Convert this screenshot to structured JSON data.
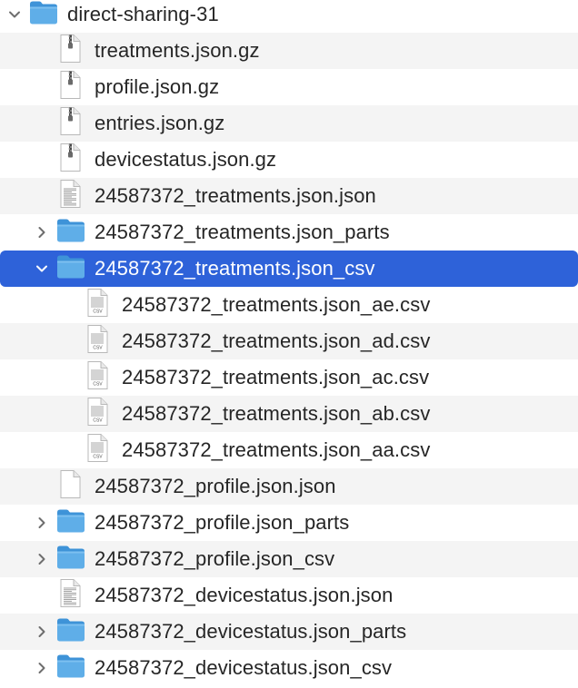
{
  "colors": {
    "selection": "#2e62d9",
    "folder_body": "#5faee8",
    "folder_tab": "#3e93d8",
    "text": "#262626",
    "selected_text": "#ffffff",
    "chevron": "#6e6e6e"
  },
  "rows": [
    {
      "label": "direct-sharing-31",
      "kind": "folder",
      "disclosure": "expanded",
      "icon": "folder-icon"
    },
    {
      "label": "treatments.json.gz",
      "kind": "gz",
      "disclosure": "none",
      "icon": "archive-file-icon"
    },
    {
      "label": "profile.json.gz",
      "kind": "gz",
      "disclosure": "none",
      "icon": "archive-file-icon"
    },
    {
      "label": "entries.json.gz",
      "kind": "gz",
      "disclosure": "none",
      "icon": "archive-file-icon"
    },
    {
      "label": "devicestatus.json.gz",
      "kind": "gz",
      "disclosure": "none",
      "icon": "archive-file-icon"
    },
    {
      "label": "24587372_treatments.json.json",
      "kind": "json",
      "disclosure": "none",
      "icon": "json-file-icon"
    },
    {
      "label": "24587372_treatments.json_parts",
      "kind": "folder",
      "disclosure": "collapsed",
      "icon": "folder-icon"
    },
    {
      "label": "24587372_treatments.json_csv",
      "kind": "folder",
      "disclosure": "expanded",
      "icon": "folder-icon",
      "selected": true
    },
    {
      "label": "24587372_treatments.json_ae.csv",
      "kind": "csv",
      "disclosure": "none",
      "icon": "csv-file-icon",
      "icon_text": "CSV"
    },
    {
      "label": "24587372_treatments.json_ad.csv",
      "kind": "csv",
      "disclosure": "none",
      "icon": "csv-file-icon",
      "icon_text": "CSV"
    },
    {
      "label": "24587372_treatments.json_ac.csv",
      "kind": "csv",
      "disclosure": "none",
      "icon": "csv-file-icon",
      "icon_text": "CSV"
    },
    {
      "label": "24587372_treatments.json_ab.csv",
      "kind": "csv",
      "disclosure": "none",
      "icon": "csv-file-icon",
      "icon_text": "CSV"
    },
    {
      "label": "24587372_treatments.json_aa.csv",
      "kind": "csv",
      "disclosure": "none",
      "icon": "csv-file-icon",
      "icon_text": "CSV"
    },
    {
      "label": "24587372_profile.json.json",
      "kind": "blank",
      "disclosure": "none",
      "icon": "blank-file-icon"
    },
    {
      "label": "24587372_profile.json_parts",
      "kind": "folder",
      "disclosure": "collapsed",
      "icon": "folder-icon"
    },
    {
      "label": "24587372_profile.json_csv",
      "kind": "folder",
      "disclosure": "collapsed",
      "icon": "folder-icon"
    },
    {
      "label": "24587372_devicestatus.json.json",
      "kind": "json",
      "disclosure": "none",
      "icon": "json-file-icon"
    },
    {
      "label": "24587372_devicestatus.json_parts",
      "kind": "folder",
      "disclosure": "collapsed",
      "icon": "folder-icon"
    },
    {
      "label": "24587372_devicestatus.json_csv",
      "kind": "folder",
      "disclosure": "collapsed",
      "icon": "folder-icon"
    }
  ]
}
